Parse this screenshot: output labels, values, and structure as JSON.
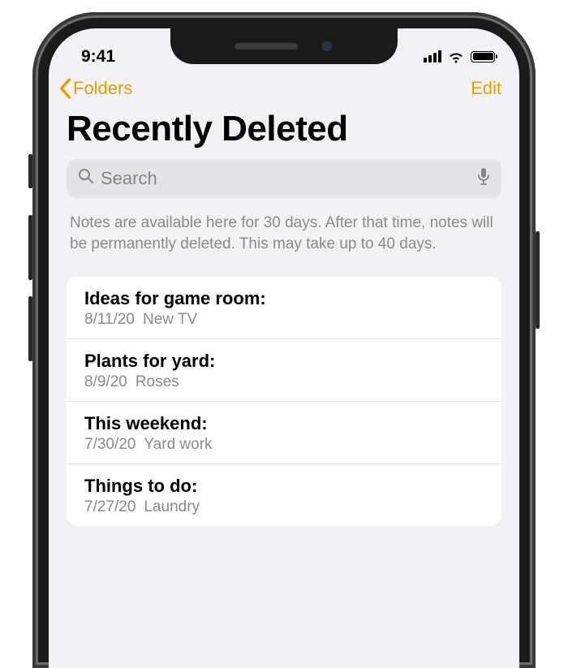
{
  "status": {
    "time": "9:41"
  },
  "nav": {
    "back_label": "Folders",
    "edit_label": "Edit"
  },
  "title": "Recently Deleted",
  "search": {
    "placeholder": "Search"
  },
  "info_text": "Notes are available here for 30 days. After that time, notes will be permanently deleted. This may take up to 40 days.",
  "notes": [
    {
      "title": "Ideas for game room:",
      "date": "8/11/20",
      "preview": "New TV"
    },
    {
      "title": "Plants for yard:",
      "date": "8/9/20",
      "preview": "Roses"
    },
    {
      "title": "This weekend:",
      "date": "7/30/20",
      "preview": "Yard work"
    },
    {
      "title": "Things to do:",
      "date": "7/27/20",
      "preview": "Laundry"
    }
  ]
}
